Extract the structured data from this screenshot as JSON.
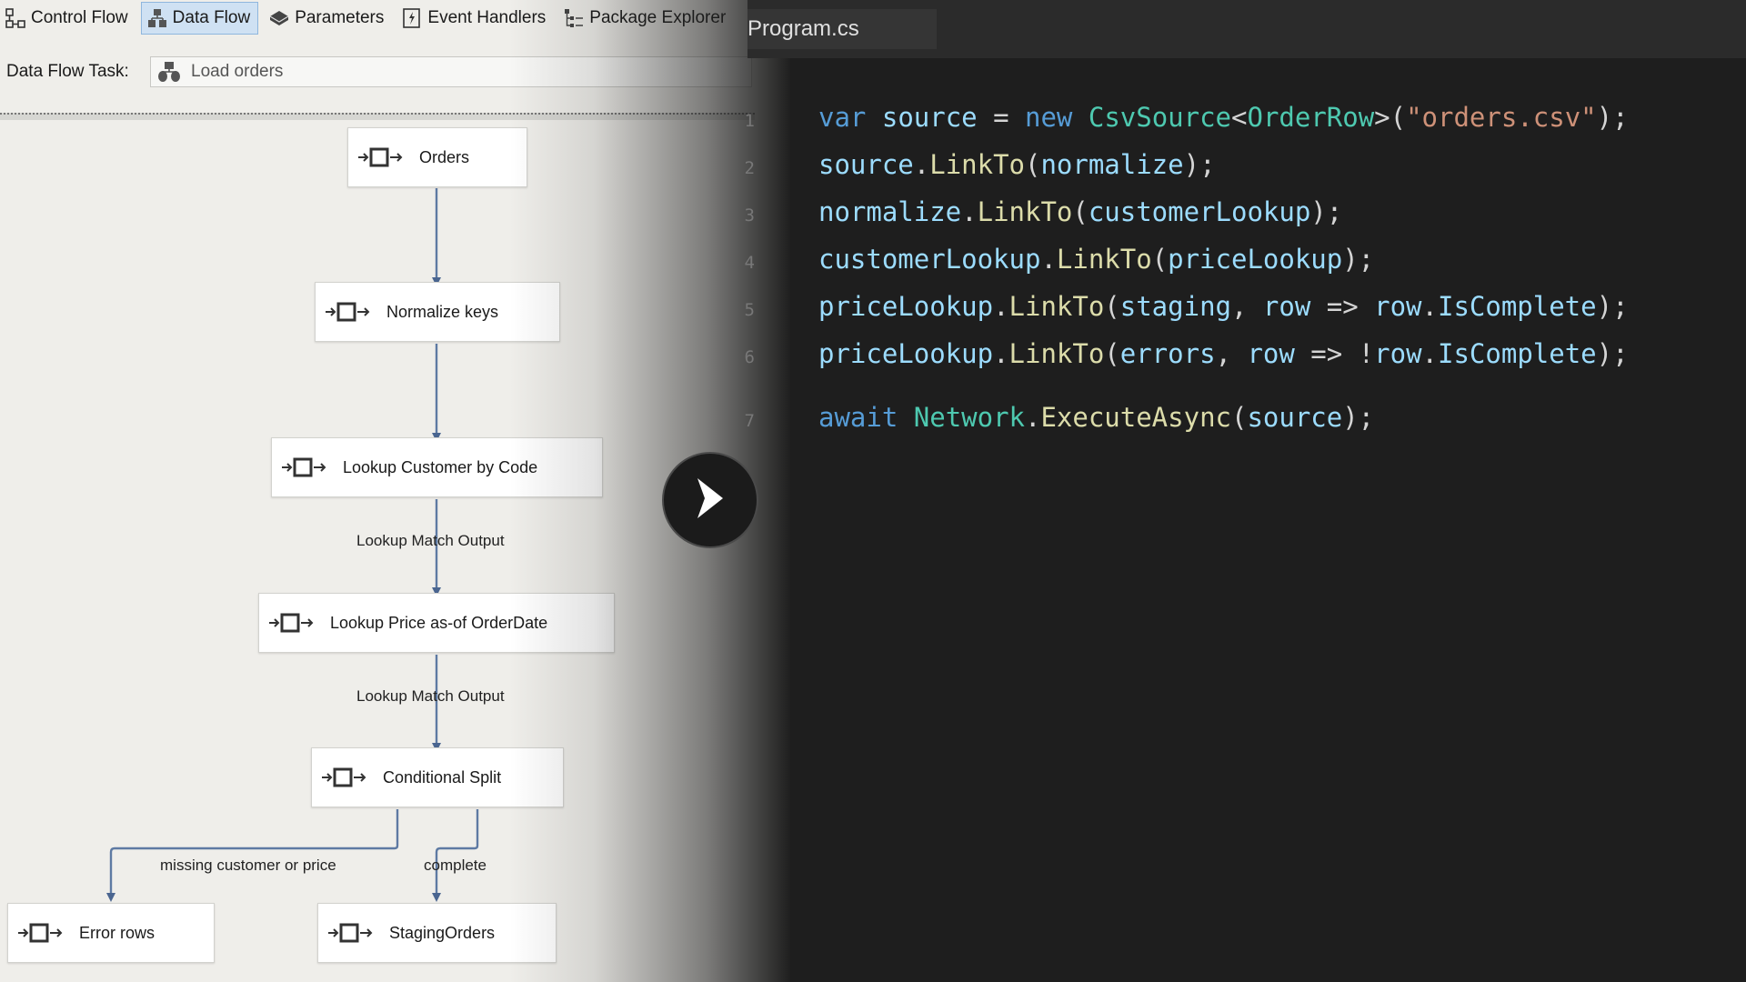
{
  "designer": {
    "tabs": [
      {
        "label": "Control Flow",
        "icon": "control-flow-icon",
        "active": false
      },
      {
        "label": "Data Flow",
        "icon": "data-flow-icon",
        "active": true
      },
      {
        "label": "Parameters",
        "icon": "parameters-icon",
        "active": false
      },
      {
        "label": "Event Handlers",
        "icon": "event-handlers-icon",
        "active": false
      },
      {
        "label": "Package Explorer",
        "icon": "package-explorer-icon",
        "active": false
      }
    ],
    "task_label": "Data Flow Task:",
    "task_value": "Load orders",
    "nodes": {
      "orders": "Orders",
      "normalize": "Normalize keys",
      "lookup_customer": "Lookup Customer by Code",
      "lookup_price": "Lookup Price as-of OrderDate",
      "conditional_split": "Conditional Split",
      "error_rows": "Error rows",
      "staging": "StagingOrders"
    },
    "path_labels": {
      "lookup_match_1": "Lookup Match Output",
      "lookup_match_2": "Lookup Match Output",
      "missing": "missing customer or price",
      "complete": "complete"
    }
  },
  "editor": {
    "tab_title": "Program.cs",
    "line_numbers": [
      "1",
      "2",
      "3",
      "4",
      "5",
      "6",
      "7"
    ],
    "colors": {
      "keyword": "#569cd6",
      "type": "#4ec9b0",
      "method": "#dcdcaa",
      "variable": "#9cdcfe",
      "string": "#ce9178"
    },
    "lines": [
      [
        [
          "kw",
          "var"
        ],
        [
          "pn",
          " "
        ],
        [
          "vr",
          "source"
        ],
        [
          "pn",
          " = "
        ],
        [
          "kw",
          "new"
        ],
        [
          "pn",
          " "
        ],
        [
          "ty",
          "CsvSource"
        ],
        [
          "pn",
          "<"
        ],
        [
          "ty",
          "OrderRow"
        ],
        [
          "pn",
          ">("
        ],
        [
          "st",
          "\"orders.csv\""
        ],
        [
          "pn",
          ");"
        ]
      ],
      [
        [
          "vr",
          "source"
        ],
        [
          "pn",
          "."
        ],
        [
          "fn",
          "LinkTo"
        ],
        [
          "pn",
          "("
        ],
        [
          "vr",
          "normalize"
        ],
        [
          "pn",
          ");"
        ]
      ],
      [
        [
          "vr",
          "normalize"
        ],
        [
          "pn",
          "."
        ],
        [
          "fn",
          "LinkTo"
        ],
        [
          "pn",
          "("
        ],
        [
          "vr",
          "customerLookup"
        ],
        [
          "pn",
          ");"
        ]
      ],
      [
        [
          "vr",
          "customerLookup"
        ],
        [
          "pn",
          "."
        ],
        [
          "fn",
          "LinkTo"
        ],
        [
          "pn",
          "("
        ],
        [
          "vr",
          "priceLookup"
        ],
        [
          "pn",
          ");"
        ]
      ],
      [
        [
          "vr",
          "priceLookup"
        ],
        [
          "pn",
          "."
        ],
        [
          "fn",
          "LinkTo"
        ],
        [
          "pn",
          "("
        ],
        [
          "vr",
          "staging"
        ],
        [
          "pn",
          ", "
        ],
        [
          "vr",
          "row"
        ],
        [
          "pn",
          " => "
        ],
        [
          "vr",
          "row"
        ],
        [
          "pn",
          "."
        ],
        [
          "vr",
          "IsComplete"
        ],
        [
          "pn",
          ");"
        ]
      ],
      [
        [
          "vr",
          "priceLookup"
        ],
        [
          "pn",
          "."
        ],
        [
          "fn",
          "LinkTo"
        ],
        [
          "pn",
          "("
        ],
        [
          "vr",
          "errors"
        ],
        [
          "pn",
          ", "
        ],
        [
          "vr",
          "row"
        ],
        [
          "pn",
          " => !"
        ],
        [
          "vr",
          "row"
        ],
        [
          "pn",
          "."
        ],
        [
          "vr",
          "IsComplete"
        ],
        [
          "pn",
          ");"
        ]
      ],
      [
        [
          "kw",
          "await"
        ],
        [
          "pn",
          " "
        ],
        [
          "ty",
          "Network"
        ],
        [
          "pn",
          "."
        ],
        [
          "fn",
          "ExecuteAsync"
        ],
        [
          "pn",
          "("
        ],
        [
          "vr",
          "source"
        ],
        [
          "pn",
          ");"
        ]
      ]
    ]
  }
}
